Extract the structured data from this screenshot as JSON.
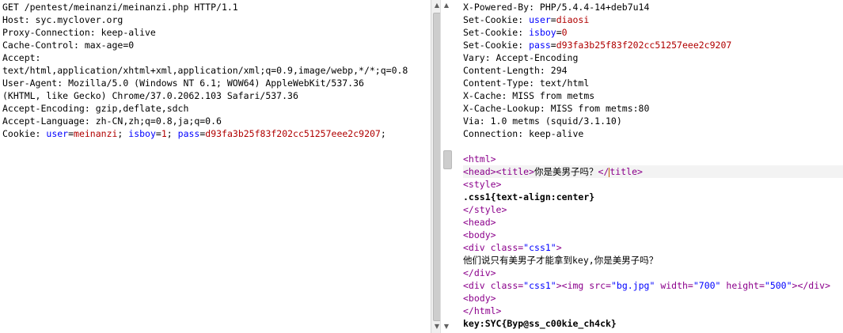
{
  "request": {
    "lines": [
      "GET /pentest/meinanzi/meinanzi.php HTTP/1.1",
      "Host: syc.myclover.org",
      "Proxy-Connection: keep-alive",
      "Cache-Control: max-age=0",
      "Accept:",
      "text/html,application/xhtml+xml,application/xml;q=0.9,image/webp,*/*;q=0.8",
      "User-Agent: Mozilla/5.0 (Windows NT 6.1; WOW64) AppleWebKit/537.36",
      "(KHTML, like Gecko) Chrome/37.0.2062.103 Safari/537.36",
      "Accept-Encoding: gzip,deflate,sdch",
      "Accept-Language: zh-CN,zh;q=0.8,ja;q=0.6"
    ],
    "cookie": {
      "label": "Cookie: ",
      "k1": "user",
      "v1": "meinanzi",
      "sep1": "; ",
      "k2": "isboy",
      "v2": "1",
      "sep2": "; ",
      "k3": "pass",
      "v3": "d93fa3b25f83f202cc51257eee2c9207",
      "end": ";"
    }
  },
  "response": {
    "headers_top": [
      "X-Powered-By: PHP/5.4.4-14+deb7u14"
    ],
    "cookies": [
      {
        "label": "Set-Cookie: ",
        "key": "user",
        "value": "diaosi"
      },
      {
        "label": "Set-Cookie: ",
        "key": "isboy",
        "value": "0"
      },
      {
        "label": "Set-Cookie: ",
        "key": "pass",
        "value": "d93fa3b25f83f202cc51257eee2c9207"
      }
    ],
    "headers_bottom": [
      "Vary: Accept-Encoding",
      "Content-Length: 294",
      "Content-Type: text/html",
      "X-Cache: MISS from metms",
      "X-Cache-Lookup: MISS from metms:80",
      "Via: 1.0 metms (squid/3.1.10)",
      "Connection: keep-alive"
    ],
    "body": {
      "html_open": "<html>",
      "head_open": "<head>",
      "title_open": "<title>",
      "title_text": "你是美男子吗？",
      "title_close_a": "</",
      "title_close_b": "title>",
      "style_open": "<style>",
      "css": ".css1{text-align:center}",
      "style_close": "</style>",
      "head_close": "<head>",
      "body_open": "<body>",
      "div_open_a": "<div ",
      "attr_class": "class=",
      "val_css1": "\"css1\"",
      "div_open_end": ">",
      "message": "他们说只有美男子才能拿到key,你是美男子吗？",
      "div_close": "</div>",
      "img_open": "<img ",
      "attr_src": "src=",
      "val_src": "\"bg.jpg\"",
      "attr_width": "width=",
      "val_width": "\"700\"",
      "attr_height": "height=",
      "val_height": "\"500\"",
      "img_end": ">",
      "body_close": "<body>",
      "html_close": "</html>",
      "key_line": "key:SYC{Byp@ss_c00kie_ch4ck}"
    }
  },
  "scrollbar": {
    "up": "▲",
    "down": "▼"
  }
}
